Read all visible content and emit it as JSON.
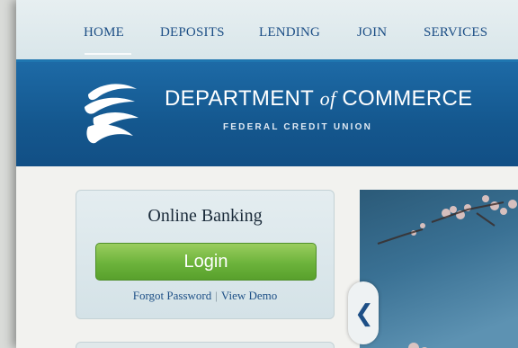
{
  "nav": {
    "items": [
      {
        "label": "HOME"
      },
      {
        "label": "DEPOSITS"
      },
      {
        "label": "LENDING"
      },
      {
        "label": "JOIN"
      },
      {
        "label": "SERVICES"
      }
    ],
    "active": "HOME"
  },
  "banner": {
    "title_part1": "DEPARTMENT",
    "title_of": "of",
    "title_part2": "COMMERCE",
    "subtitle": "FEDERAL CREDIT UNION",
    "logo_icon": "eagle-swoosh-logo-icon"
  },
  "login": {
    "title": "Online Banking",
    "button_label": "Login",
    "forgot_link": "Forgot Password",
    "separator": "|",
    "demo_link": "View Demo"
  },
  "carousel": {
    "prev_icon": "chevron-left-icon",
    "prev_glyph": "❮"
  },
  "colors": {
    "nav_text": "#1d4f86",
    "banner_blue": "#14578e",
    "login_green": "#6cb33b"
  }
}
